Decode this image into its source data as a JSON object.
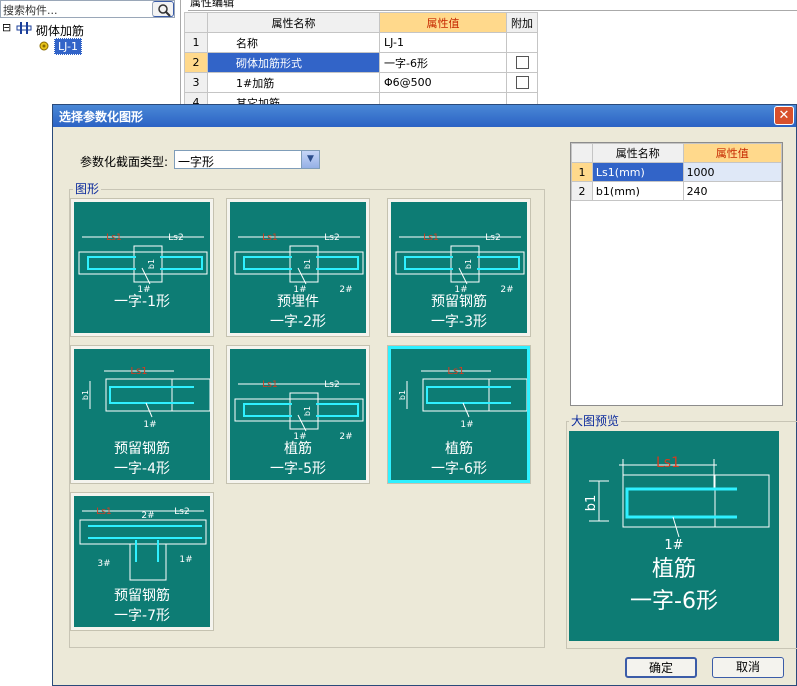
{
  "tree": {
    "search_placeholder": "搜索构件...",
    "root_label": "砌体加筋",
    "child_label": "LJ-1",
    "collapse_glyph": "⊟"
  },
  "panel_title": "属性编辑",
  "bg_table": {
    "headers": [
      "属性名称",
      "属性值",
      "附加"
    ],
    "rows": [
      {
        "idx": "1",
        "name": "名称",
        "value": "LJ-1"
      },
      {
        "idx": "2",
        "name": "砌体加筋形式",
        "value": "一字-6形"
      },
      {
        "idx": "3",
        "name": "1#加筋",
        "value": "Φ6@500"
      },
      {
        "idx": "4",
        "name": "其它加筋",
        "value": ""
      }
    ]
  },
  "dialog": {
    "title": "选择参数化图形",
    "close_glyph": "✕",
    "type_label": "参数化截面类型:",
    "type_value": "一字形",
    "shapes_group_label": "图形",
    "preview_group_label": "大图预览",
    "ok_label": "确定",
    "cancel_label": "取消"
  },
  "shapes": [
    {
      "line1": "一字-1形",
      "line2": ""
    },
    {
      "line1": "预埋件",
      "line2": "一字-2形"
    },
    {
      "line1": "预留钢筋",
      "line2": "一字-3形"
    },
    {
      "line1": "预留钢筋",
      "line2": "一字-4形"
    },
    {
      "line1": "植筋",
      "line2": "一字-5形"
    },
    {
      "line1": "植筋",
      "line2": "一字-6形"
    },
    {
      "line1": "预留钢筋",
      "line2": "一字-7形"
    }
  ],
  "drawing_labels": {
    "ls1": "Ls1",
    "ls2": "Ls2",
    "b1": "b1",
    "bar1": "1#",
    "bar2": "2#",
    "bar3": "3#"
  },
  "param_table": {
    "headers": [
      "属性名称",
      "属性值"
    ],
    "rows": [
      {
        "idx": "1",
        "name": "Ls1(mm)",
        "value": "1000"
      },
      {
        "idx": "2",
        "name": "b1(mm)",
        "value": "240"
      }
    ]
  },
  "preview": {
    "line1": "植筋",
    "line2": "一字-6形"
  },
  "colors": {
    "tile_bg": "#0d7c74",
    "rebar": "#2ff0ff",
    "dim_text": "#d63b1f",
    "selected_border": "#2ff0ff"
  }
}
